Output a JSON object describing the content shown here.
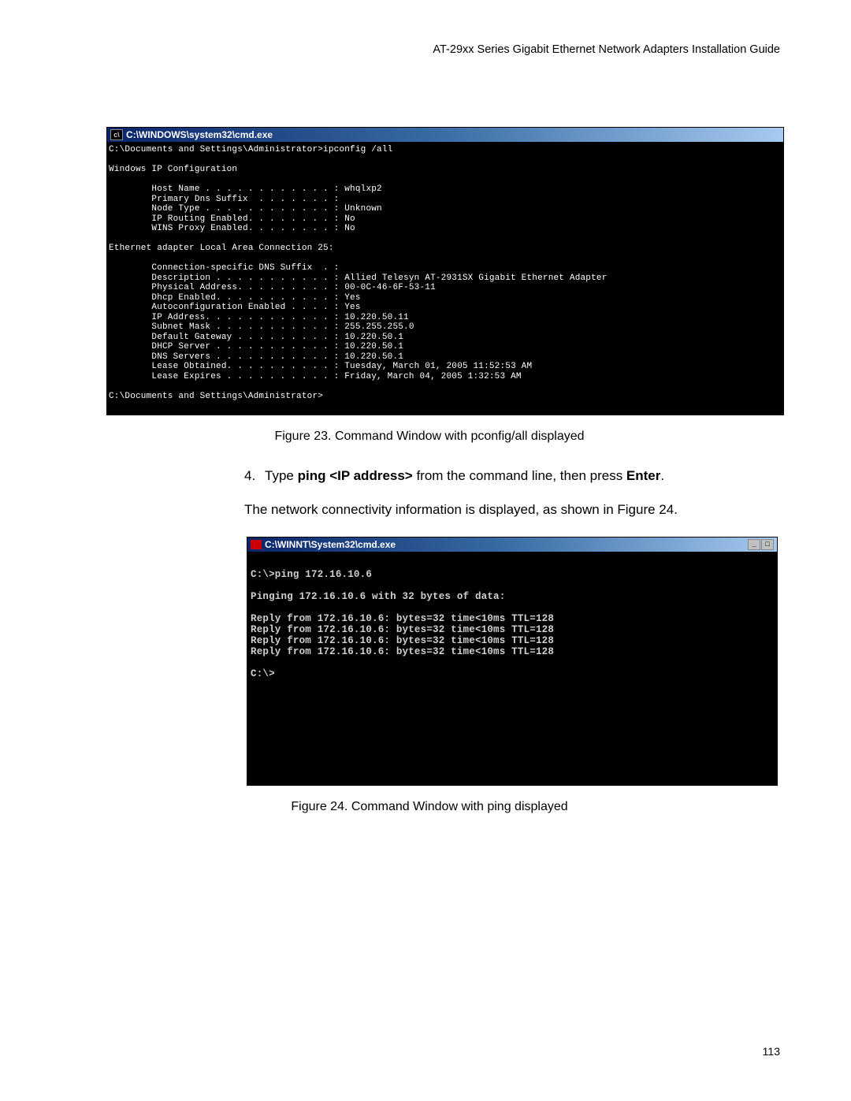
{
  "header": "AT-29xx Series Gigabit Ethernet Network Adapters Installation Guide",
  "page_number": "113",
  "figure23": {
    "title": "C:\\WINDOWS\\system32\\cmd.exe",
    "caption": "Figure 23. Command Window with pconfig/all displayed",
    "body": "C:\\Documents and Settings\\Administrator>ipconfig /all\n\nWindows IP Configuration\n\n        Host Name . . . . . . . . . . . . : whqlxp2\n        Primary Dns Suffix  . . . . . . . :\n        Node Type . . . . . . . . . . . . : Unknown\n        IP Routing Enabled. . . . . . . . : No\n        WINS Proxy Enabled. . . . . . . . : No\n\nEthernet adapter Local Area Connection 25:\n\n        Connection-specific DNS Suffix  . :\n        Description . . . . . . . . . . . : Allied Telesyn AT-2931SX Gigabit Ethernet Adapter\n        Physical Address. . . . . . . . . : 00-0C-46-6F-53-11\n        Dhcp Enabled. . . . . . . . . . . : Yes\n        Autoconfiguration Enabled . . . . : Yes\n        IP Address. . . . . . . . . . . . : 10.220.50.11\n        Subnet Mask . . . . . . . . . . . : 255.255.255.0\n        Default Gateway . . . . . . . . . : 10.220.50.1\n        DHCP Server . . . . . . . . . . . : 10.220.50.1\n        DNS Servers . . . . . . . . . . . : 10.220.50.1\n        Lease Obtained. . . . . . . . . . : Tuesday, March 01, 2005 11:52:53 AM\n        Lease Expires . . . . . . . . . . : Friday, March 04, 2005 1:32:53 AM\n\nC:\\Documents and Settings\\Administrator>\n\n"
  },
  "step4": {
    "number": "4.",
    "text_prefix": "Type ",
    "text_cmd": "ping <IP address>",
    "text_mid": " from the command line, then press ",
    "text_bold2": "Enter",
    "text_suffix": "."
  },
  "para1": "The network connectivity information is displayed, as shown in Figure 24.",
  "figure24": {
    "title": "C:\\WINNT\\System32\\cmd.exe",
    "caption": "Figure 24. Command Window with ping displayed",
    "body": "\nC:\\>ping 172.16.10.6\n\nPinging 172.16.10.6 with 32 bytes of data:\n\nReply from 172.16.10.6: bytes=32 time<10ms TTL=128\nReply from 172.16.10.6: bytes=32 time<10ms TTL=128\nReply from 172.16.10.6: bytes=32 time<10ms TTL=128\nReply from 172.16.10.6: bytes=32 time<10ms TTL=128\n\nC:\\>\n"
  }
}
